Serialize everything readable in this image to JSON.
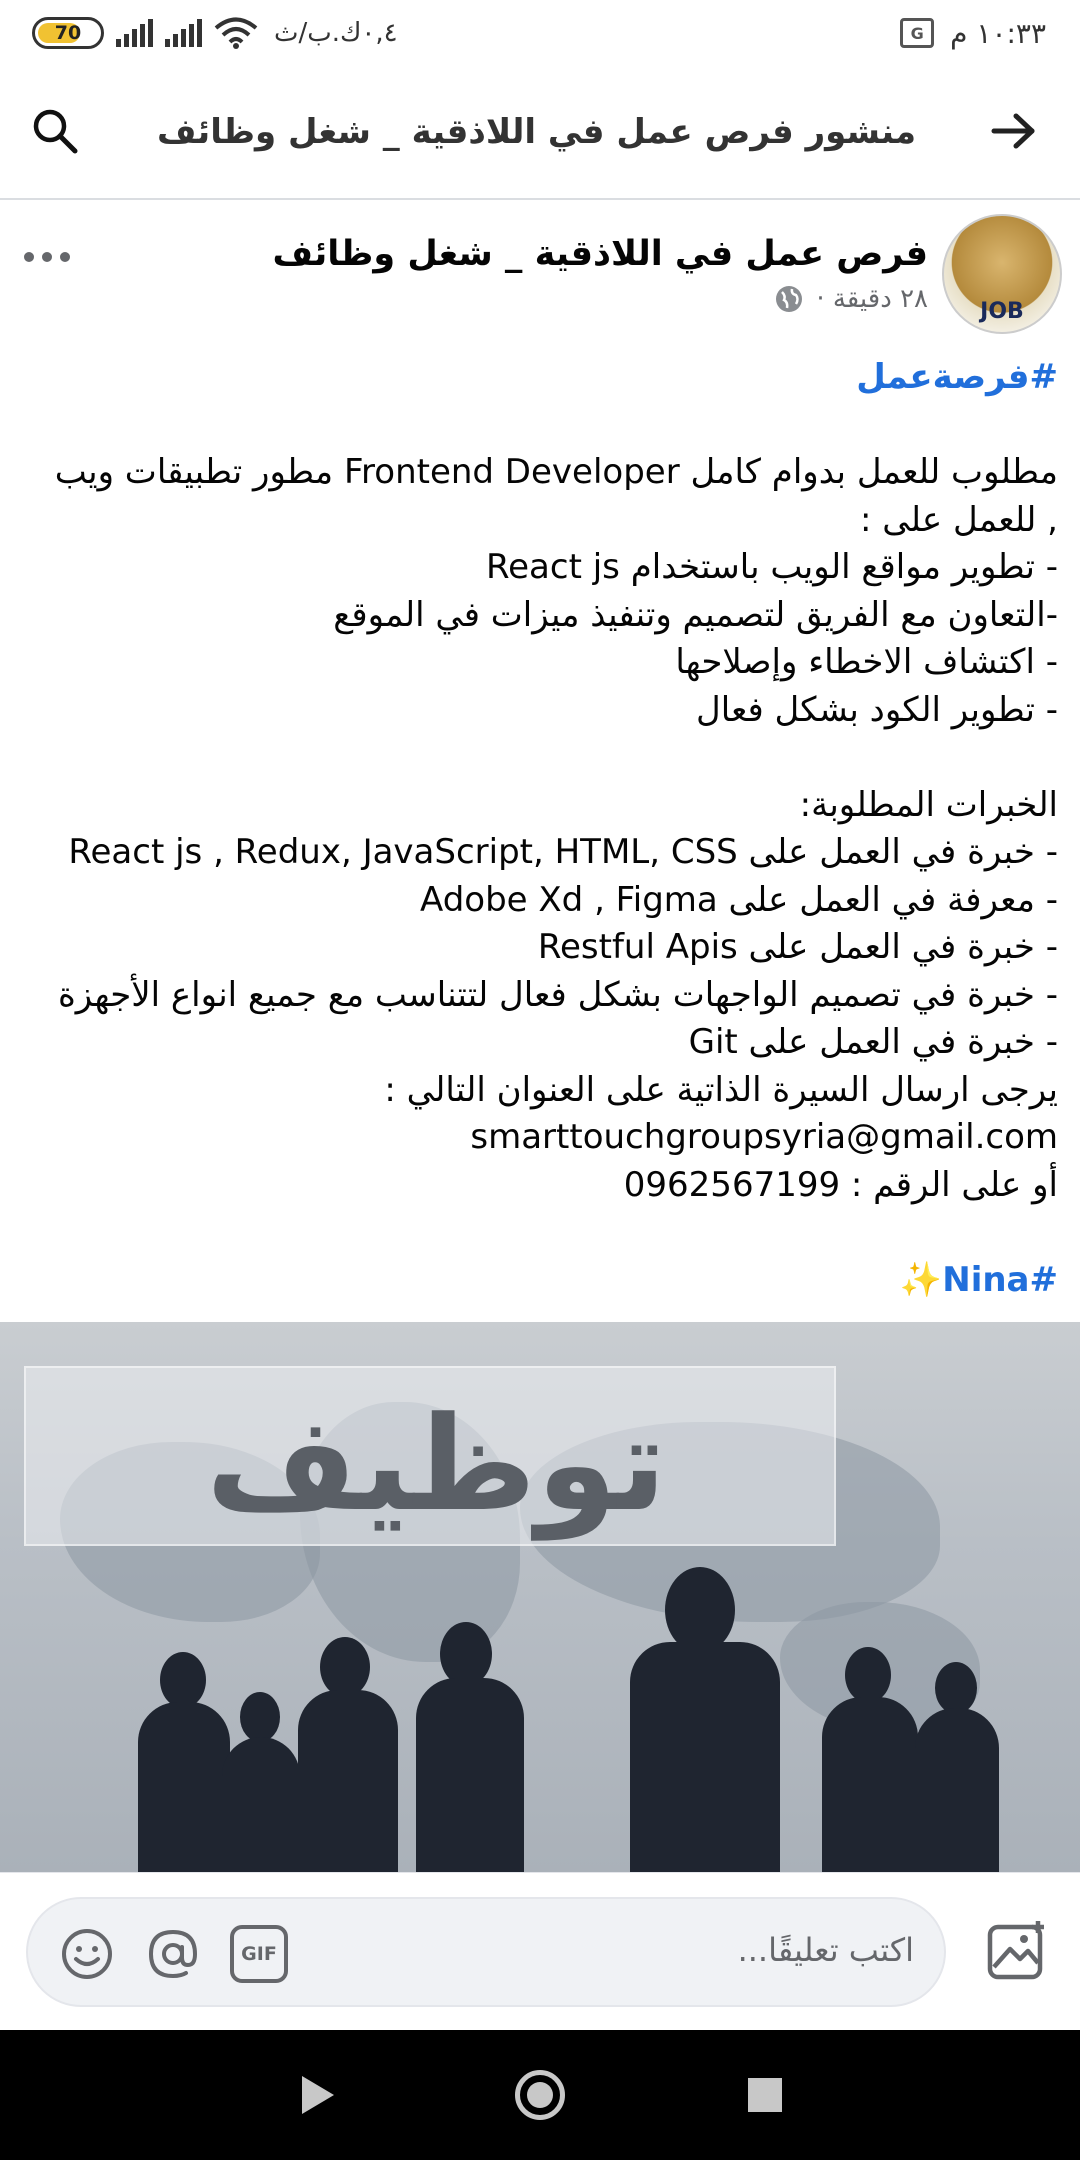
{
  "status_bar": {
    "battery": "70",
    "battery_level": 0.7,
    "speed": "٠,٤ك.ب/ث",
    "time": "١٠:٣٣ م",
    "translate_icon_label": "G"
  },
  "app_bar": {
    "title": "منشور فرص عمل في اللاذقية _ شغل وظائف"
  },
  "post": {
    "page_name": "فرص عمل في اللاذقية _ شغل وظائف",
    "time_ago": "٢٨ دقيقة ·",
    "avatar_text": "JOB",
    "hashtag_top": "#فرصةعمل",
    "lines": [
      "مطلوب للعمل بدوام كامل  Frontend Developer مطور تطبيقات ويب",
      ", للعمل على :",
      "- تطوير مواقع الويب باستخدام React js",
      "-التعاون مع الفريق لتصميم وتنفيذ ميزات في الموقع",
      "- اكتشاف الاخطاء وإصلاحها",
      "- تطوير الكود بشكل فعال",
      "الخبرات المطلوبة:",
      "- خبرة في العمل على React js , Redux, JavaScript, HTML, CSS",
      "- معرفة في العمل على Adobe Xd , Figma",
      "- خبرة في العمل على Restful Apis",
      "- خبرة في تصميم الواجهات بشكل فعال لتتناسب مع جميع انواع الأجهزة",
      "- خبرة في العمل على Git",
      "يرجى ارسال السيرة الذاتية على العنوان التالي :",
      "smarttouchgroupsyria@gmail.com",
      "أو على الرقم : 0962567199"
    ],
    "hashtag_bottom": "#Nina✨",
    "image_text": "توظيف"
  },
  "comment_bar": {
    "placeholder": "اكتب تعليقًا...",
    "gif_label": "GIF"
  },
  "colors": {
    "link": "#216fdb",
    "text": "#050505",
    "secondary": "#65676b",
    "input_bg": "#f0f2f5"
  }
}
